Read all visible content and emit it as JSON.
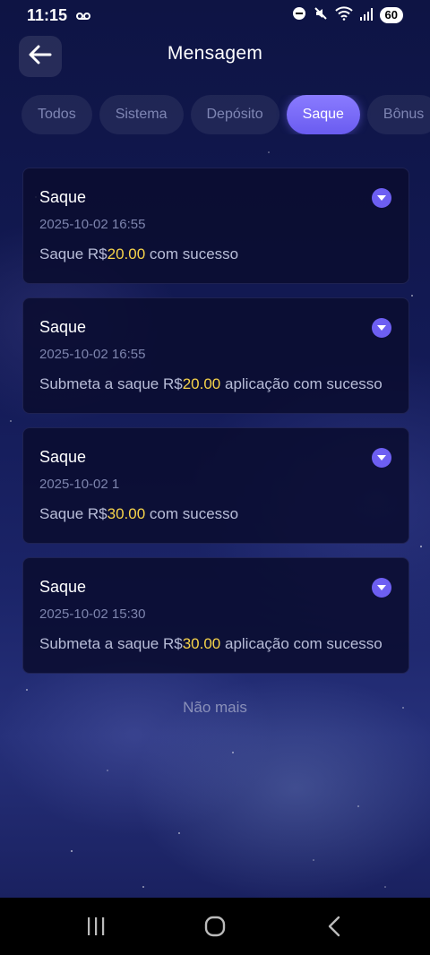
{
  "status_bar": {
    "time": "11:15",
    "battery": "60"
  },
  "header": {
    "title": "Mensagem",
    "back_icon": "arrow-left-icon"
  },
  "tabs": [
    {
      "label": "Todos",
      "active": false
    },
    {
      "label": "Sistema",
      "active": false
    },
    {
      "label": "Depósito",
      "active": false
    },
    {
      "label": "Saque",
      "active": true
    },
    {
      "label": "Bônus",
      "active": false
    }
  ],
  "messages": [
    {
      "title": "Saque",
      "time": "2025-10-02 16:55",
      "prefix": "Saque R$",
      "amount": "20.00",
      "suffix": " com sucesso"
    },
    {
      "title": "Saque",
      "time": "2025-10-02 16:55",
      "prefix": "Submeta a saque R$",
      "amount": "20.00",
      "suffix": " aplicação com sucesso"
    },
    {
      "title": "Saque",
      "time": "2025-10-02 1",
      "prefix": "Saque R$",
      "amount": "30.00",
      "suffix": " com sucesso"
    },
    {
      "title": "Saque",
      "time": "2025-10-02 15:30",
      "prefix": "Submeta a saque R$",
      "amount": "30.00",
      "suffix": " aplicação com sucesso"
    }
  ],
  "footer_text": "Não mais",
  "colors": {
    "accent": "#6d5ff2",
    "amount": "#f6d34a",
    "background": "#131a55"
  }
}
